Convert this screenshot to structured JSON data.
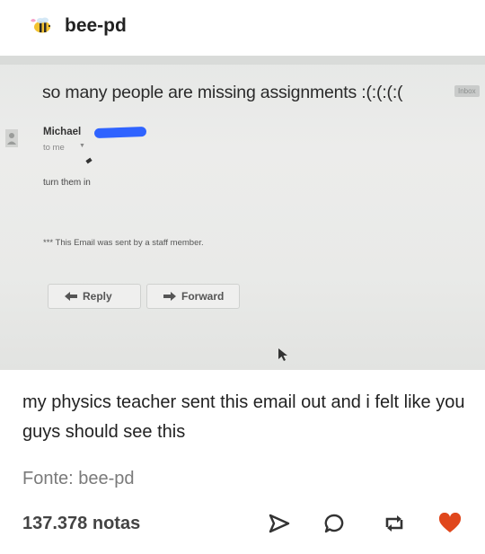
{
  "post": {
    "blog_name": "bee-pd",
    "caption": "my physics teacher sent this email out and i felt like you guys should see this",
    "source_label": "Fonte:",
    "source_name": "bee-pd",
    "notes": "137.378 notas"
  },
  "photo_email": {
    "subject": "so many people are missing assignments :(:(:(:(",
    "inbox_tag": "Inbox",
    "sender": "Michael",
    "recipient": "to me",
    "body": "turn them in",
    "staff_notice": "*** This Email was sent by a staff member.",
    "reply_label": "Reply",
    "forward_label": "Forward"
  },
  "icons": {
    "avatar": "bee-icon",
    "share": "paper-plane-icon",
    "reply": "speech-bubble-icon",
    "reblog": "reblog-icon",
    "like": "heart-icon"
  },
  "colors": {
    "like": "#e0471c",
    "redaction": "#2f63ff"
  }
}
